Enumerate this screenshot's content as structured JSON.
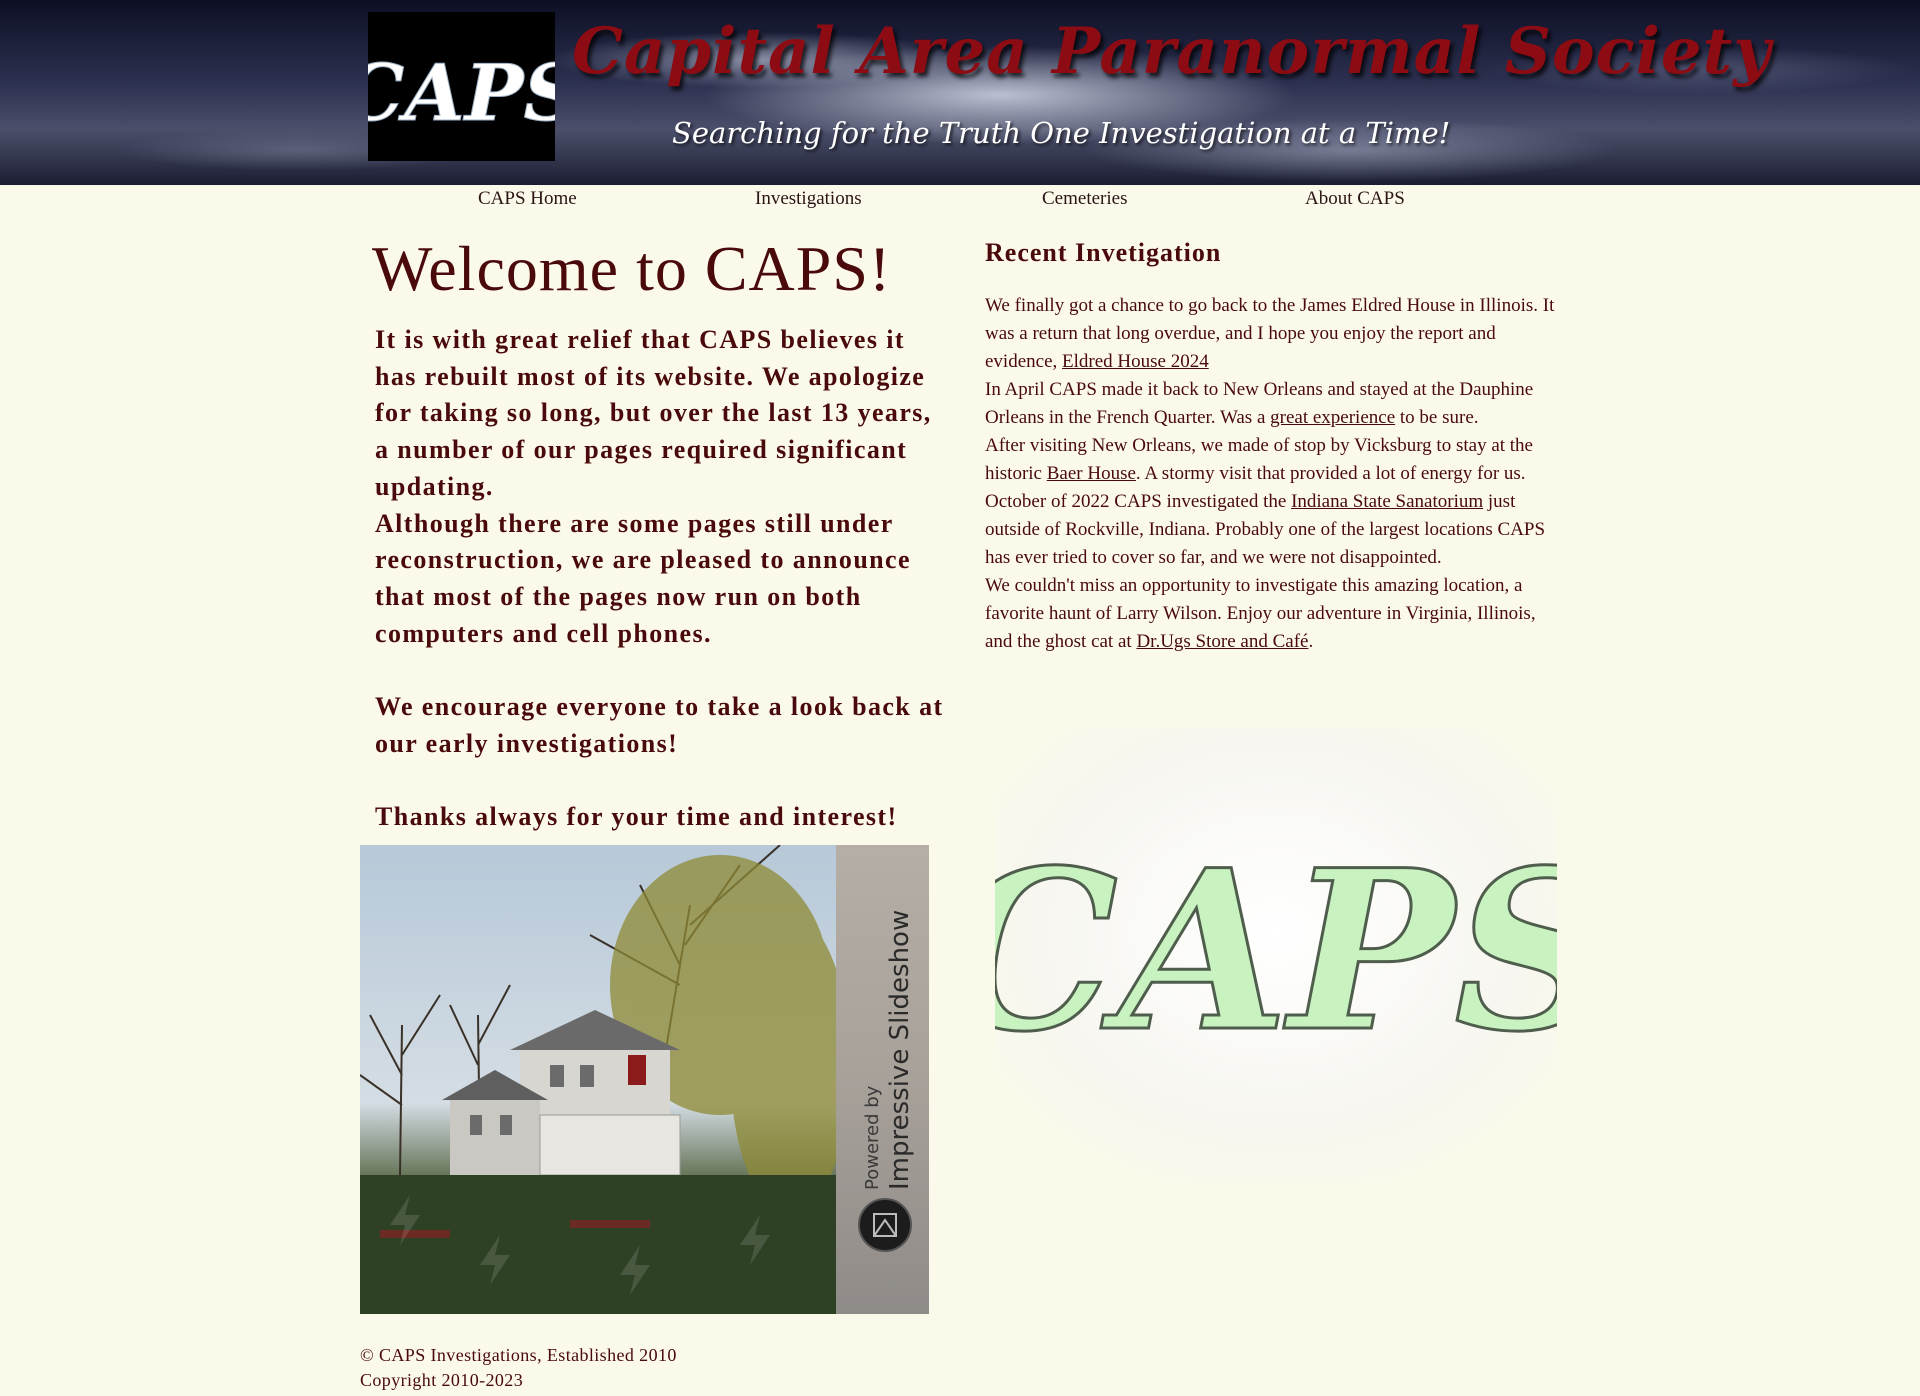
{
  "header": {
    "logo_text": "CAPS",
    "title": "Capital Area Paranormal Society",
    "tagline": "Searching for the Truth One Investigation at a Time!"
  },
  "nav": {
    "items": [
      "CAPS Home",
      "Investigations",
      "Cemeteries",
      "About CAPS"
    ]
  },
  "welcome": {
    "title": "Welcome to CAPS!",
    "paragraphs": [
      "It is with great relief that CAPS believes it has rebuilt most of its website.  We apologize for taking so long, but over the last 13 years, a number of our pages required significant updating.",
      "Although there are some pages still under reconstruction, we are pleased to announce that most of the pages now run on both computers and cell phones.",
      "We encourage everyone to take a look back at our early investigations!",
      "Thanks always for your time and interest!"
    ]
  },
  "slideshow": {
    "powered_by": "Powered by",
    "brand": "Impressive Slideshow"
  },
  "recent": {
    "heading": "Recent Invetigation",
    "entries": [
      {
        "before": "We finally got a chance to go back to the James Eldred House in Illinois.  It was a return that long overdue, and I hope you enjoy the report and evidence, ",
        "link": "Eldred House 2024",
        "after": ""
      },
      {
        "before": "In April CAPS made it back to New Orleans and stayed at the Dauphine Orleans in the French Quarter.  Was a ",
        "link": "great experience",
        "after": " to be sure."
      },
      {
        "before": "After visiting New Orleans, we made of stop by Vicksburg to stay at the historic ",
        "link": "Baer House",
        "after": ".  A stormy visit that provided a lot of energy for us."
      },
      {
        "before": "October of 2022 CAPS investigated the ",
        "link": "Indiana State Sanatorium",
        "after": " just outside of Rockville, Indiana.  Probably one of the largest locations CAPS has ever tried to cover so far, and we were not disappointed."
      },
      {
        "before": "We couldn't miss an opportunity to investigate this amazing location, a favorite haunt of Larry Wilson.  Enjoy our adventure in Virginia, Illinois, and the ghost cat at ",
        "link": "Dr.Ugs Store and Café",
        "after": "."
      }
    ]
  },
  "big_logo_text": "CAPS",
  "footer": {
    "line1": "© CAPS Investigations, Established 2010",
    "line2": "Copyright 2010-2023"
  },
  "colors": {
    "page_background": "#faf9ea",
    "text": "#4a0a0c",
    "banner_title": "#8d0c13",
    "logo_green": "#c8f2c0"
  }
}
